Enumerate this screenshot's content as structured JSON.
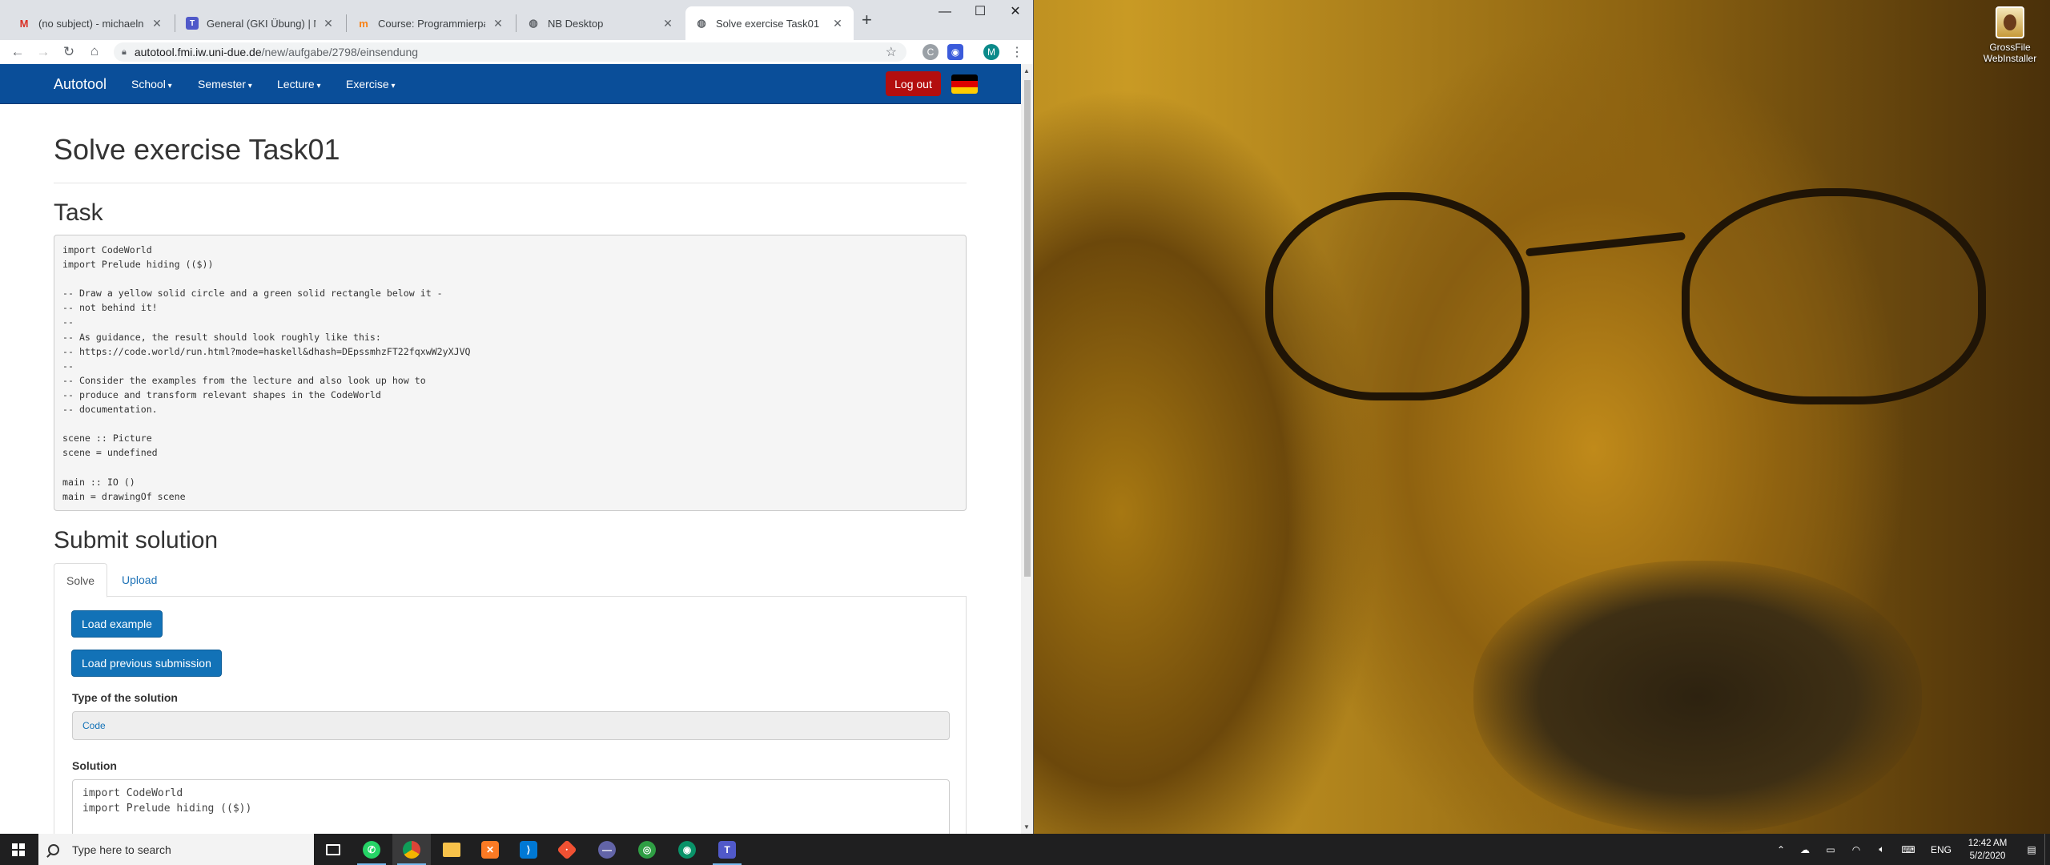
{
  "browser": {
    "tabs": [
      {
        "title": "(no subject) - michaelnadal",
        "icon": "gmail-icon"
      },
      {
        "title": "General (GKI Übung) | Micro",
        "icon": "teams-icon"
      },
      {
        "title": "Course: Programmierparadi",
        "icon": "moodle-icon"
      },
      {
        "title": "NB Desktop",
        "icon": "globe-icon"
      },
      {
        "title": "Solve exercise Task01",
        "icon": "globe-icon"
      }
    ],
    "new_tab_label": "+",
    "url_host": "autotool.fmi.iw.uni-due.de",
    "url_path": "/new/aufgabe/2798/einsendung",
    "profile_initial": "M"
  },
  "site_nav": {
    "brand": "Autotool",
    "items": [
      "School",
      "Semester",
      "Lecture",
      "Exercise"
    ],
    "logout_label": "Log out"
  },
  "page": {
    "title": "Solve exercise Task01",
    "task_heading": "Task",
    "task_code": "import CodeWorld\nimport Prelude hiding (($))\n\n-- Draw a yellow solid circle and a green solid rectangle below it -\n-- not behind it!\n--\n-- As guidance, the result should look roughly like this:\n-- https://code.world/run.html?mode=haskell&dhash=DEpssmhzFT22fqxwW2yXJVQ\n--\n-- Consider the examples from the lecture and also look up how to\n-- produce and transform relevant shapes in the CodeWorld\n-- documentation.\n\nscene :: Picture\nscene = undefined\n\nmain :: IO ()\nmain = drawingOf scene",
    "submit_heading": "Submit solution",
    "tab_solve": "Solve",
    "tab_upload": "Upload",
    "load_example_label": "Load example",
    "load_previous_label": "Load previous submission",
    "type_label": "Type of the solution",
    "type_value": "Code",
    "solution_label": "Solution",
    "solution_code": "import CodeWorld\nimport Prelude hiding (($))\n\n-- Draw a yellow solid circle and a green solid rectangle below it -"
  },
  "desktop": {
    "icon_label_1": "GrossFile",
    "icon_label_2": "WebInstaller"
  },
  "taskbar": {
    "search_placeholder": "Type here to search",
    "language": "ENG",
    "time": "12:42 AM",
    "date": "5/2/2020"
  }
}
